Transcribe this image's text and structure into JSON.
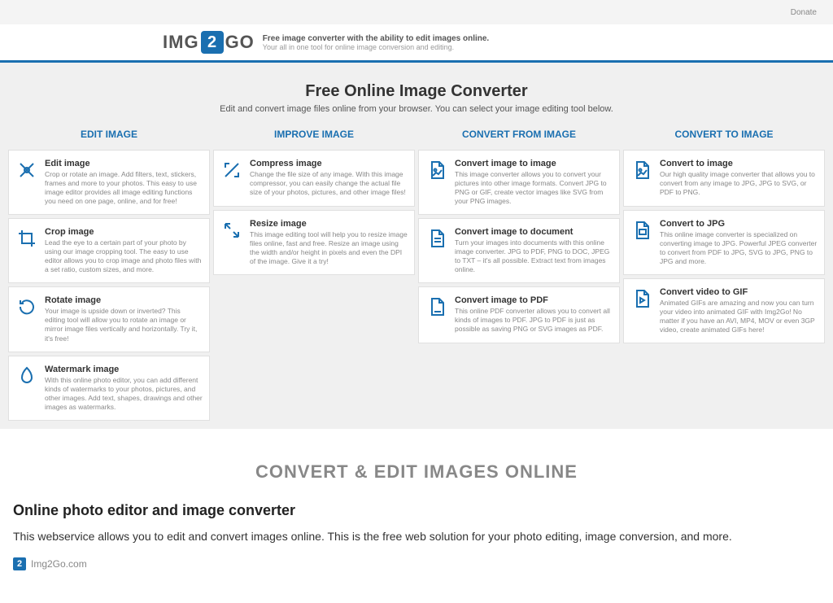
{
  "topbar": {
    "donate": "Donate"
  },
  "logo": {
    "pre": "IMG",
    "badge": "2",
    "post": "GO",
    "tagline1": "Free image converter with the ability to edit images online.",
    "tagline2": "Your all in one tool for online image conversion and editing."
  },
  "hero": {
    "title": "Free Online Image Converter",
    "subtitle": "Edit and convert image files online from your browser. You can select your image editing tool below."
  },
  "columns": {
    "edit": {
      "header": "EDIT IMAGE",
      "cards": [
        {
          "title": "Edit image",
          "desc": "Crop or rotate an image. Add filters, text, stickers, frames and more to your photos. This easy to use image editor provides all image editing functions you need on one page, online, and for free!"
        },
        {
          "title": "Crop image",
          "desc": "Lead the eye to a certain part of your photo by using our image cropping tool. The easy to use editor allows you to crop image and photo files with a set ratio, custom sizes, and more."
        },
        {
          "title": "Rotate image",
          "desc": "Your image is upside down or inverted? This editing tool will allow you to rotate an image or mirror image files vertically and horizontally. Try it, it's free!"
        },
        {
          "title": "Watermark image",
          "desc": "With this online photo editor, you can add different kinds of watermarks to your photos, pictures, and other images. Add text, shapes, drawings and other images as watermarks."
        }
      ]
    },
    "improve": {
      "header": "IMPROVE IMAGE",
      "cards": [
        {
          "title": "Compress image",
          "desc": "Change the file size of any image. With this image compressor, you can easily change the actual file size of your photos, pictures, and other image files!"
        },
        {
          "title": "Resize image",
          "desc": "This image editing tool will help you to resize image files online, fast and free. Resize an image using the width and/or height in pixels and even the DPI of the image. Give it a try!"
        }
      ]
    },
    "from": {
      "header": "CONVERT FROM IMAGE",
      "cards": [
        {
          "title": "Convert image to image",
          "desc": "This image converter allows you to convert your pictures into other image formats. Convert JPG to PNG or GIF, create vector images like SVG from your PNG images."
        },
        {
          "title": "Convert image to document",
          "desc": "Turn your images into documents with this online image converter. JPG to PDF, PNG to DOC, JPEG to TXT – it's all possible. Extract text from images online."
        },
        {
          "title": "Convert image to PDF",
          "desc": "This online PDF converter allows you to convert all kinds of images to PDF. JPG to PDF is just as possible as saving PNG or SVG images as PDF."
        }
      ]
    },
    "to": {
      "header": "CONVERT TO IMAGE",
      "cards": [
        {
          "title": "Convert to image",
          "desc": "Our high quality image converter that allows you to convert from any image to JPG, JPG to SVG, or PDF to PNG."
        },
        {
          "title": "Convert to JPG",
          "desc": "This online image converter is specialized on converting image to JPG. Powerful JPEG converter to convert from PDF to JPG, SVG to JPG, PNG to JPG and more."
        },
        {
          "title": "Convert video to GIF",
          "desc": "Animated GIFs are amazing and now you can turn your video into animated GIF with Img2Go! No matter if you have an AVI, MP4, MOV or even 3GP video, create animated GIFs here!"
        }
      ]
    }
  },
  "bottom": {
    "banner": "CONVERT & EDIT IMAGES ONLINE",
    "heading": "Online photo editor and image converter",
    "paragraph": "This webservice allows you to edit and convert images online. This is the free web solution for your photo editing, image conversion, and more.",
    "source_badge": "2",
    "source_text": "Img2Go.com"
  }
}
